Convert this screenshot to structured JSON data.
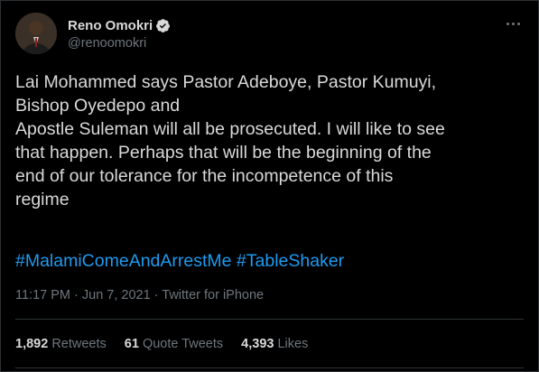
{
  "author": {
    "display_name": "Reno Omokri",
    "handle": "@renoomokri",
    "verified": true
  },
  "tweet": {
    "lines": [
      "Lai Mohammed says Pastor Adeboye, Pastor Kumuyi,",
      "Bishop Oyedepo and",
      "Apostle Suleman will all be prosecuted. I will like to see",
      "that happen. Perhaps that will be the beginning of the",
      "end of our tolerance for the incompetence of this",
      "regime"
    ],
    "hashtags": [
      "#MalamiComeAndArrestMe",
      "#TableShaker"
    ]
  },
  "meta": {
    "timestamp": "11:17 PM · Jun 7, 2021 · Twitter for iPhone"
  },
  "stats": {
    "retweets_count": "1,892",
    "retweets_label": "Retweets",
    "quotes_count": "61",
    "quotes_label": "Quote Tweets",
    "likes_count": "4,393",
    "likes_label": "Likes"
  },
  "colors": {
    "background": "#000000",
    "text": "#d9d9d9",
    "secondary_text": "#6e767d",
    "link": "#1d9bf0",
    "divider": "#2f3336",
    "verified_badge": "#d9d9d9"
  },
  "icons": {
    "verified": "verified-badge-icon",
    "more": "more-options-icon"
  }
}
